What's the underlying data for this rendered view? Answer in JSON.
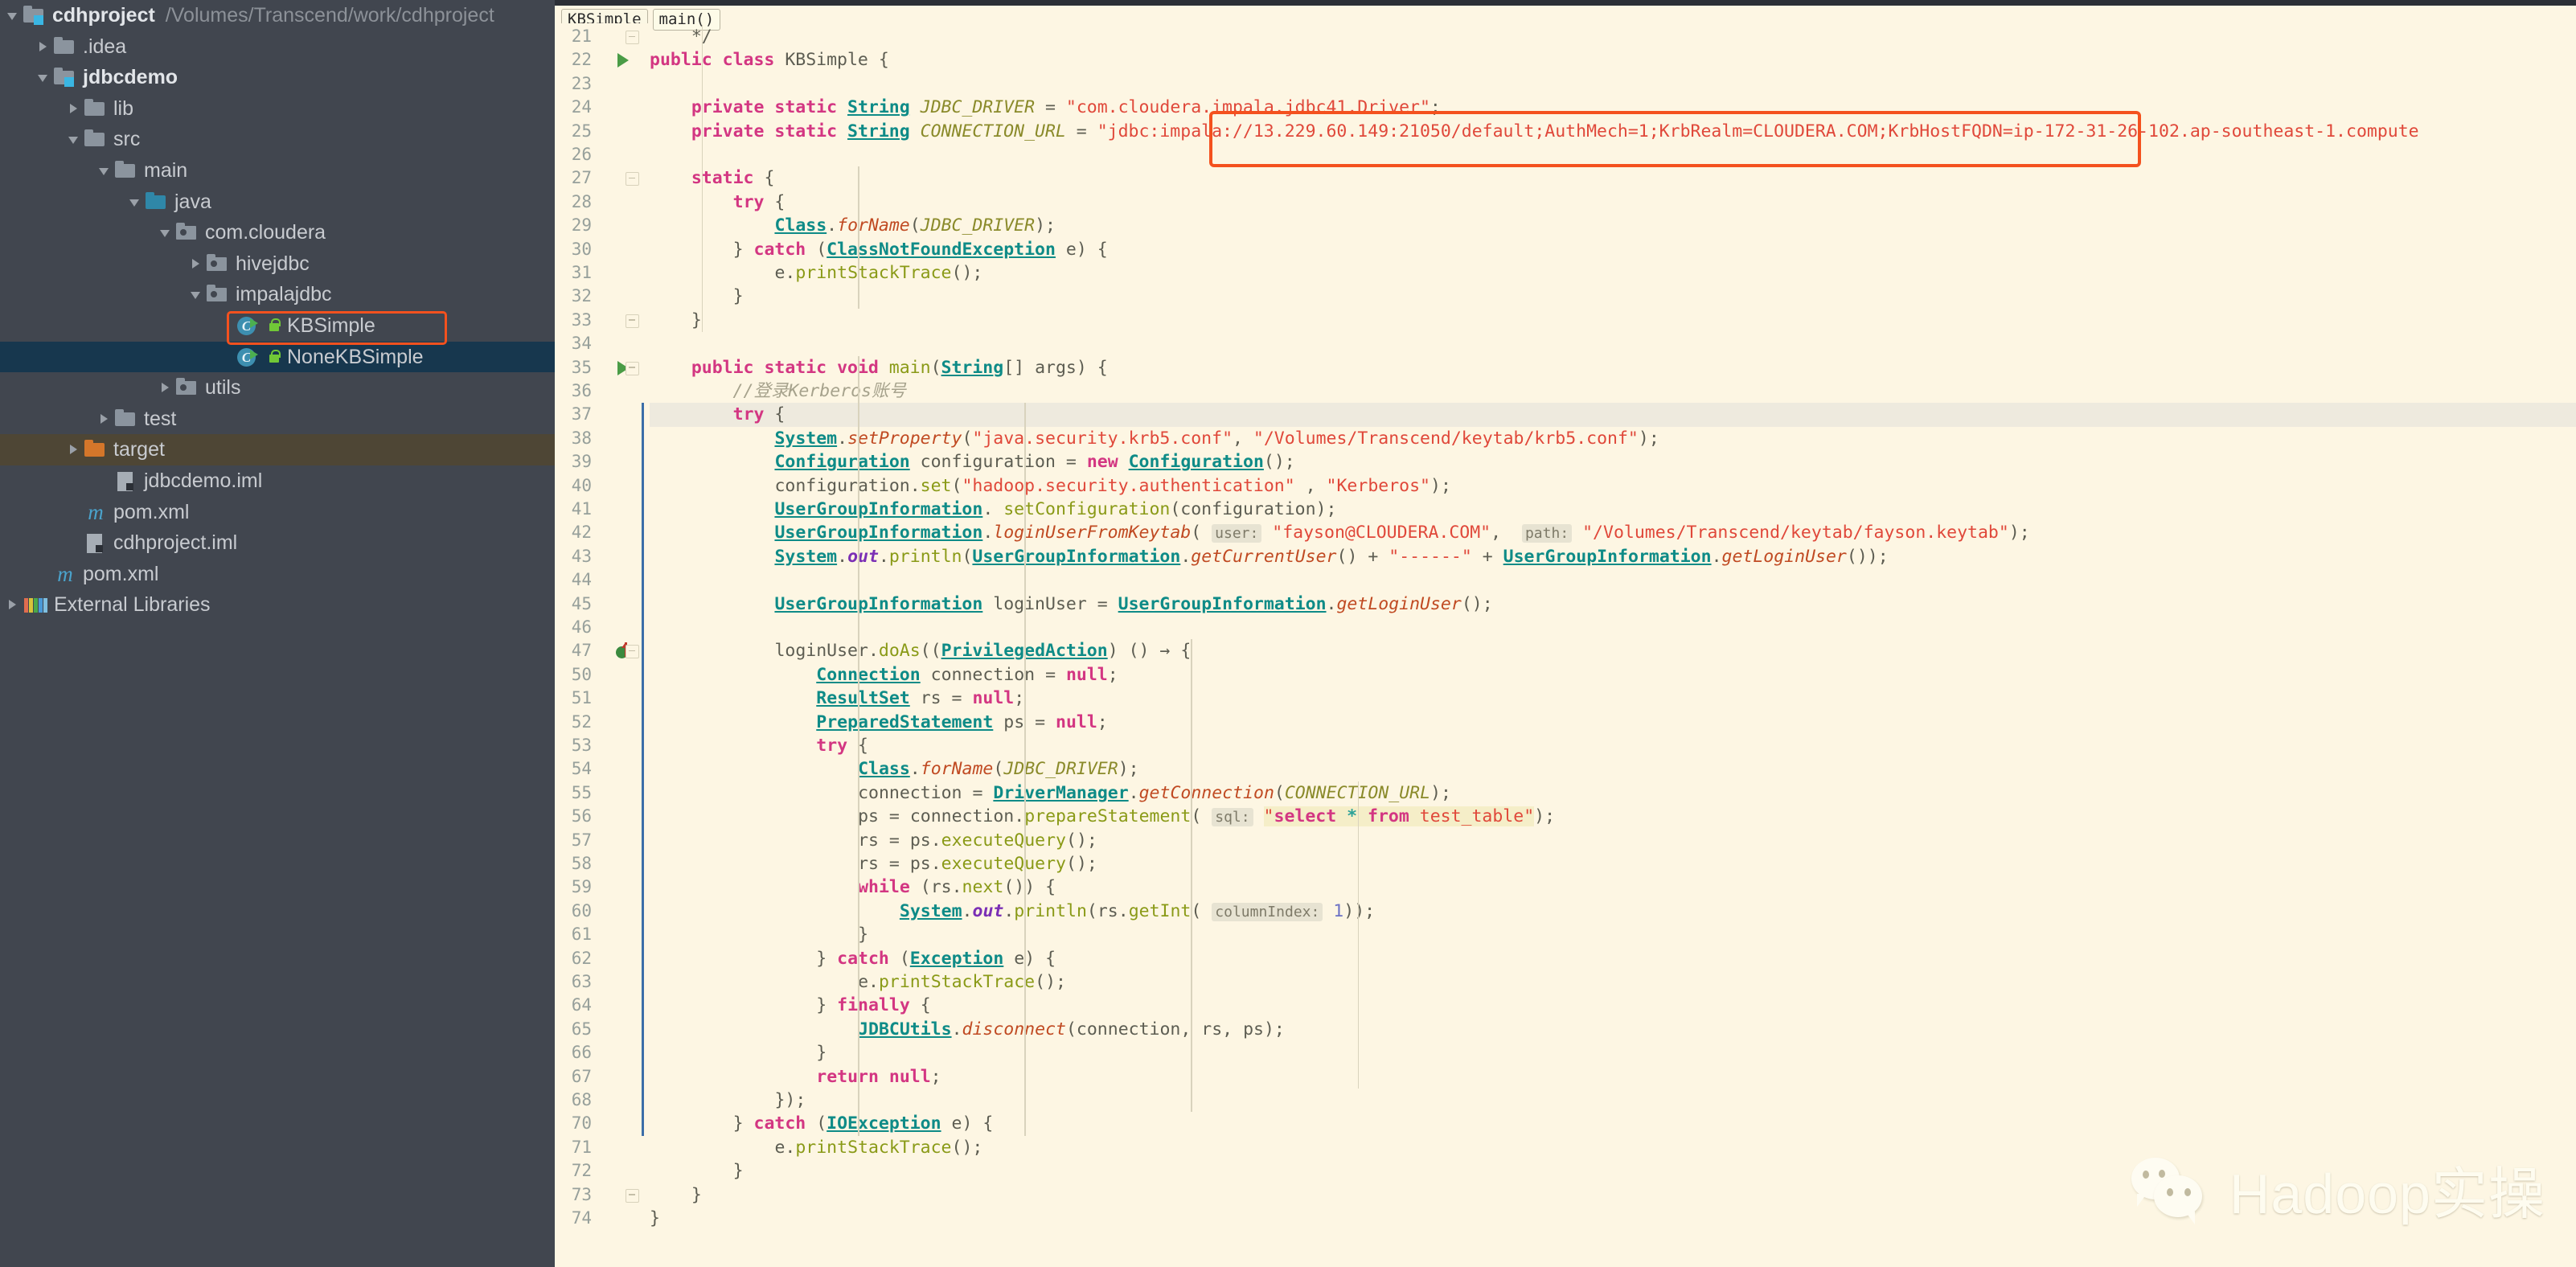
{
  "sidebar": {
    "items": [
      {
        "label": "cdhproject",
        "path": "/Volumes/Transcend/work/cdhproject",
        "icon": "module-folder-icon",
        "depth": 0,
        "arrow": "open",
        "bold": true
      },
      {
        "label": ".idea",
        "path": "",
        "icon": "folder-icon",
        "depth": 1,
        "arrow": "closed",
        "bold": false
      },
      {
        "label": "jdbcdemo",
        "path": "",
        "icon": "module-folder-icon",
        "depth": 1,
        "arrow": "open",
        "bold": true
      },
      {
        "label": "lib",
        "path": "",
        "icon": "folder-icon",
        "depth": 2,
        "arrow": "closed",
        "bold": false
      },
      {
        "label": "src",
        "path": "",
        "icon": "folder-icon",
        "depth": 2,
        "arrow": "open",
        "bold": false
      },
      {
        "label": "main",
        "path": "",
        "icon": "folder-icon",
        "depth": 3,
        "arrow": "open",
        "bold": false
      },
      {
        "label": "java",
        "path": "",
        "icon": "source-root-folder-icon",
        "depth": 4,
        "arrow": "open",
        "bold": false
      },
      {
        "label": "com.cloudera",
        "path": "",
        "icon": "package-icon",
        "depth": 5,
        "arrow": "open",
        "bold": false
      },
      {
        "label": "hivejdbc",
        "path": "",
        "icon": "package-icon",
        "depth": 6,
        "arrow": "closed",
        "bold": false
      },
      {
        "label": "impalajdbc",
        "path": "",
        "icon": "package-icon",
        "depth": 6,
        "arrow": "open",
        "bold": false
      },
      {
        "label": "KBSimple",
        "path": "",
        "icon": "java-class-icon",
        "depth": 7,
        "arrow": "none",
        "bold": false,
        "lock": true,
        "highlighted": true
      },
      {
        "label": "NoneKBSimple",
        "path": "",
        "icon": "java-class-icon",
        "depth": 7,
        "arrow": "none",
        "bold": false,
        "lock": true,
        "selected": true
      },
      {
        "label": "utils",
        "path": "",
        "icon": "package-icon",
        "depth": 5,
        "arrow": "closed",
        "bold": false
      },
      {
        "label": "test",
        "path": "",
        "icon": "folder-icon",
        "depth": 3,
        "arrow": "closed",
        "bold": false
      },
      {
        "label": "target",
        "path": "",
        "icon": "excluded-folder-icon",
        "depth": 2,
        "arrow": "closed",
        "bold": false,
        "target": true
      },
      {
        "label": "jdbcdemo.iml",
        "path": "",
        "icon": "iml-file-icon",
        "depth": 3,
        "arrow": "none",
        "bold": false
      },
      {
        "label": "pom.xml",
        "path": "",
        "icon": "maven-file-icon",
        "depth": 2,
        "arrow": "none",
        "bold": false
      },
      {
        "label": "cdhproject.iml",
        "path": "",
        "icon": "iml-file-icon",
        "depth": 2,
        "arrow": "none",
        "bold": false
      },
      {
        "label": "pom.xml",
        "path": "",
        "icon": "maven-file-icon",
        "depth": 1,
        "arrow": "none",
        "bold": false
      },
      {
        "label": "External Libraries",
        "path": "",
        "icon": "external-libraries-icon",
        "depth": 0,
        "arrow": "closed",
        "bold": false
      }
    ]
  },
  "editor": {
    "breadcrumb": [
      {
        "label": "KBSimple",
        "active": false
      },
      {
        "label": "main()",
        "active": true
      }
    ],
    "annotation_color": "#f4511e",
    "background": "#fdf6e3",
    "first_line": 21,
    "lines": [
      {
        "n": "21",
        "text": "    */",
        "fold": true
      },
      {
        "n": "22",
        "text": "public class KBSimple {",
        "run": true
      },
      {
        "n": "23",
        "text": ""
      },
      {
        "n": "24",
        "text": "    private static String JDBC_DRIVER = \"com.cloudera.impala.jdbc41.Driver\";"
      },
      {
        "n": "25",
        "text": "    private static String CONNECTION_URL = \"jdbc:impala://13.229.60.149:21050/default;AuthMech=1;KrbRealm=CLOUDERA.COM;KrbHostFQDN=ip-172-31-26-102.ap-southeast-1.compute"
      },
      {
        "n": "26",
        "text": ""
      },
      {
        "n": "27",
        "text": "    static {",
        "fold": true
      },
      {
        "n": "28",
        "text": "        try {"
      },
      {
        "n": "29",
        "text": "            Class.forName(JDBC_DRIVER);"
      },
      {
        "n": "30",
        "text": "        } catch (ClassNotFoundException e) {"
      },
      {
        "n": "31",
        "text": "            e.printStackTrace();"
      },
      {
        "n": "32",
        "text": "        }"
      },
      {
        "n": "33",
        "text": "    }",
        "fold": true
      },
      {
        "n": "34",
        "text": ""
      },
      {
        "n": "35",
        "text": "    public static void main(String[] args) {",
        "run": true,
        "fold": true
      },
      {
        "n": "36",
        "text": "        //登录Kerberos账号"
      },
      {
        "n": "37",
        "text": "        try {",
        "current": true
      },
      {
        "n": "38",
        "text": "            System.setProperty(\"java.security.krb5.conf\", \"/Volumes/Transcend/keytab/krb5.conf\");"
      },
      {
        "n": "39",
        "text": "            Configuration configuration = new Configuration();"
      },
      {
        "n": "40",
        "text": "            configuration.set(\"hadoop.security.authentication\" , \"Kerberos\");"
      },
      {
        "n": "41",
        "text": "            UserGroupInformation. setConfiguration(configuration);"
      },
      {
        "n": "42",
        "text": "            UserGroupInformation.loginUserFromKeytab( user: \"fayson@CLOUDERA.COM\",  path: \"/Volumes/Transcend/keytab/fayson.keytab\");"
      },
      {
        "n": "43",
        "text": "            System.out.println(UserGroupInformation.getCurrentUser() + \"------\" + UserGroupInformation.getLoginUser());"
      },
      {
        "n": "44",
        "text": ""
      },
      {
        "n": "45",
        "text": "            UserGroupInformation loginUser = UserGroupInformation.getLoginUser();"
      },
      {
        "n": "46",
        "text": ""
      },
      {
        "n": "47",
        "text": "            loginUser.doAs((PrivilegedAction) () → {",
        "lambda": true,
        "fold": true
      },
      {
        "n": "50",
        "text": "                Connection connection = null;"
      },
      {
        "n": "51",
        "text": "                ResultSet rs = null;"
      },
      {
        "n": "52",
        "text": "                PreparedStatement ps = null;"
      },
      {
        "n": "53",
        "text": "                try {"
      },
      {
        "n": "54",
        "text": "                    Class.forName(JDBC_DRIVER);"
      },
      {
        "n": "55",
        "text": "                    connection = DriverManager.getConnection(CONNECTION_URL);"
      },
      {
        "n": "56",
        "text": "                    ps = connection.prepareStatement( sql: \"select * from test_table\");"
      },
      {
        "n": "57",
        "text": "                    rs = ps.executeQuery();"
      },
      {
        "n": "58",
        "text": "                    rs = ps.executeQuery();"
      },
      {
        "n": "59",
        "text": "                    while (rs.next()) {"
      },
      {
        "n": "60",
        "text": "                        System.out.println(rs.getInt( columnIndex: 1));"
      },
      {
        "n": "61",
        "text": "                    }"
      },
      {
        "n": "62",
        "text": "                } catch (Exception e) {"
      },
      {
        "n": "63",
        "text": "                    e.printStackTrace();"
      },
      {
        "n": "64",
        "text": "                } finally {"
      },
      {
        "n": "65",
        "text": "                    JDBCUtils.disconnect(connection, rs, ps);"
      },
      {
        "n": "66",
        "text": "                }"
      },
      {
        "n": "67",
        "text": "                return null;"
      },
      {
        "n": "68",
        "text": "            });"
      },
      {
        "n": "70",
        "text": "        } catch (IOException e) {"
      },
      {
        "n": "71",
        "text": "            e.printStackTrace();"
      },
      {
        "n": "72",
        "text": "        }"
      },
      {
        "n": "73",
        "text": "    }",
        "fold": true
      },
      {
        "n": "74",
        "text": "}"
      }
    ]
  },
  "watermark": {
    "text": "Hadoop实操",
    "icon": "wechat-icon"
  }
}
